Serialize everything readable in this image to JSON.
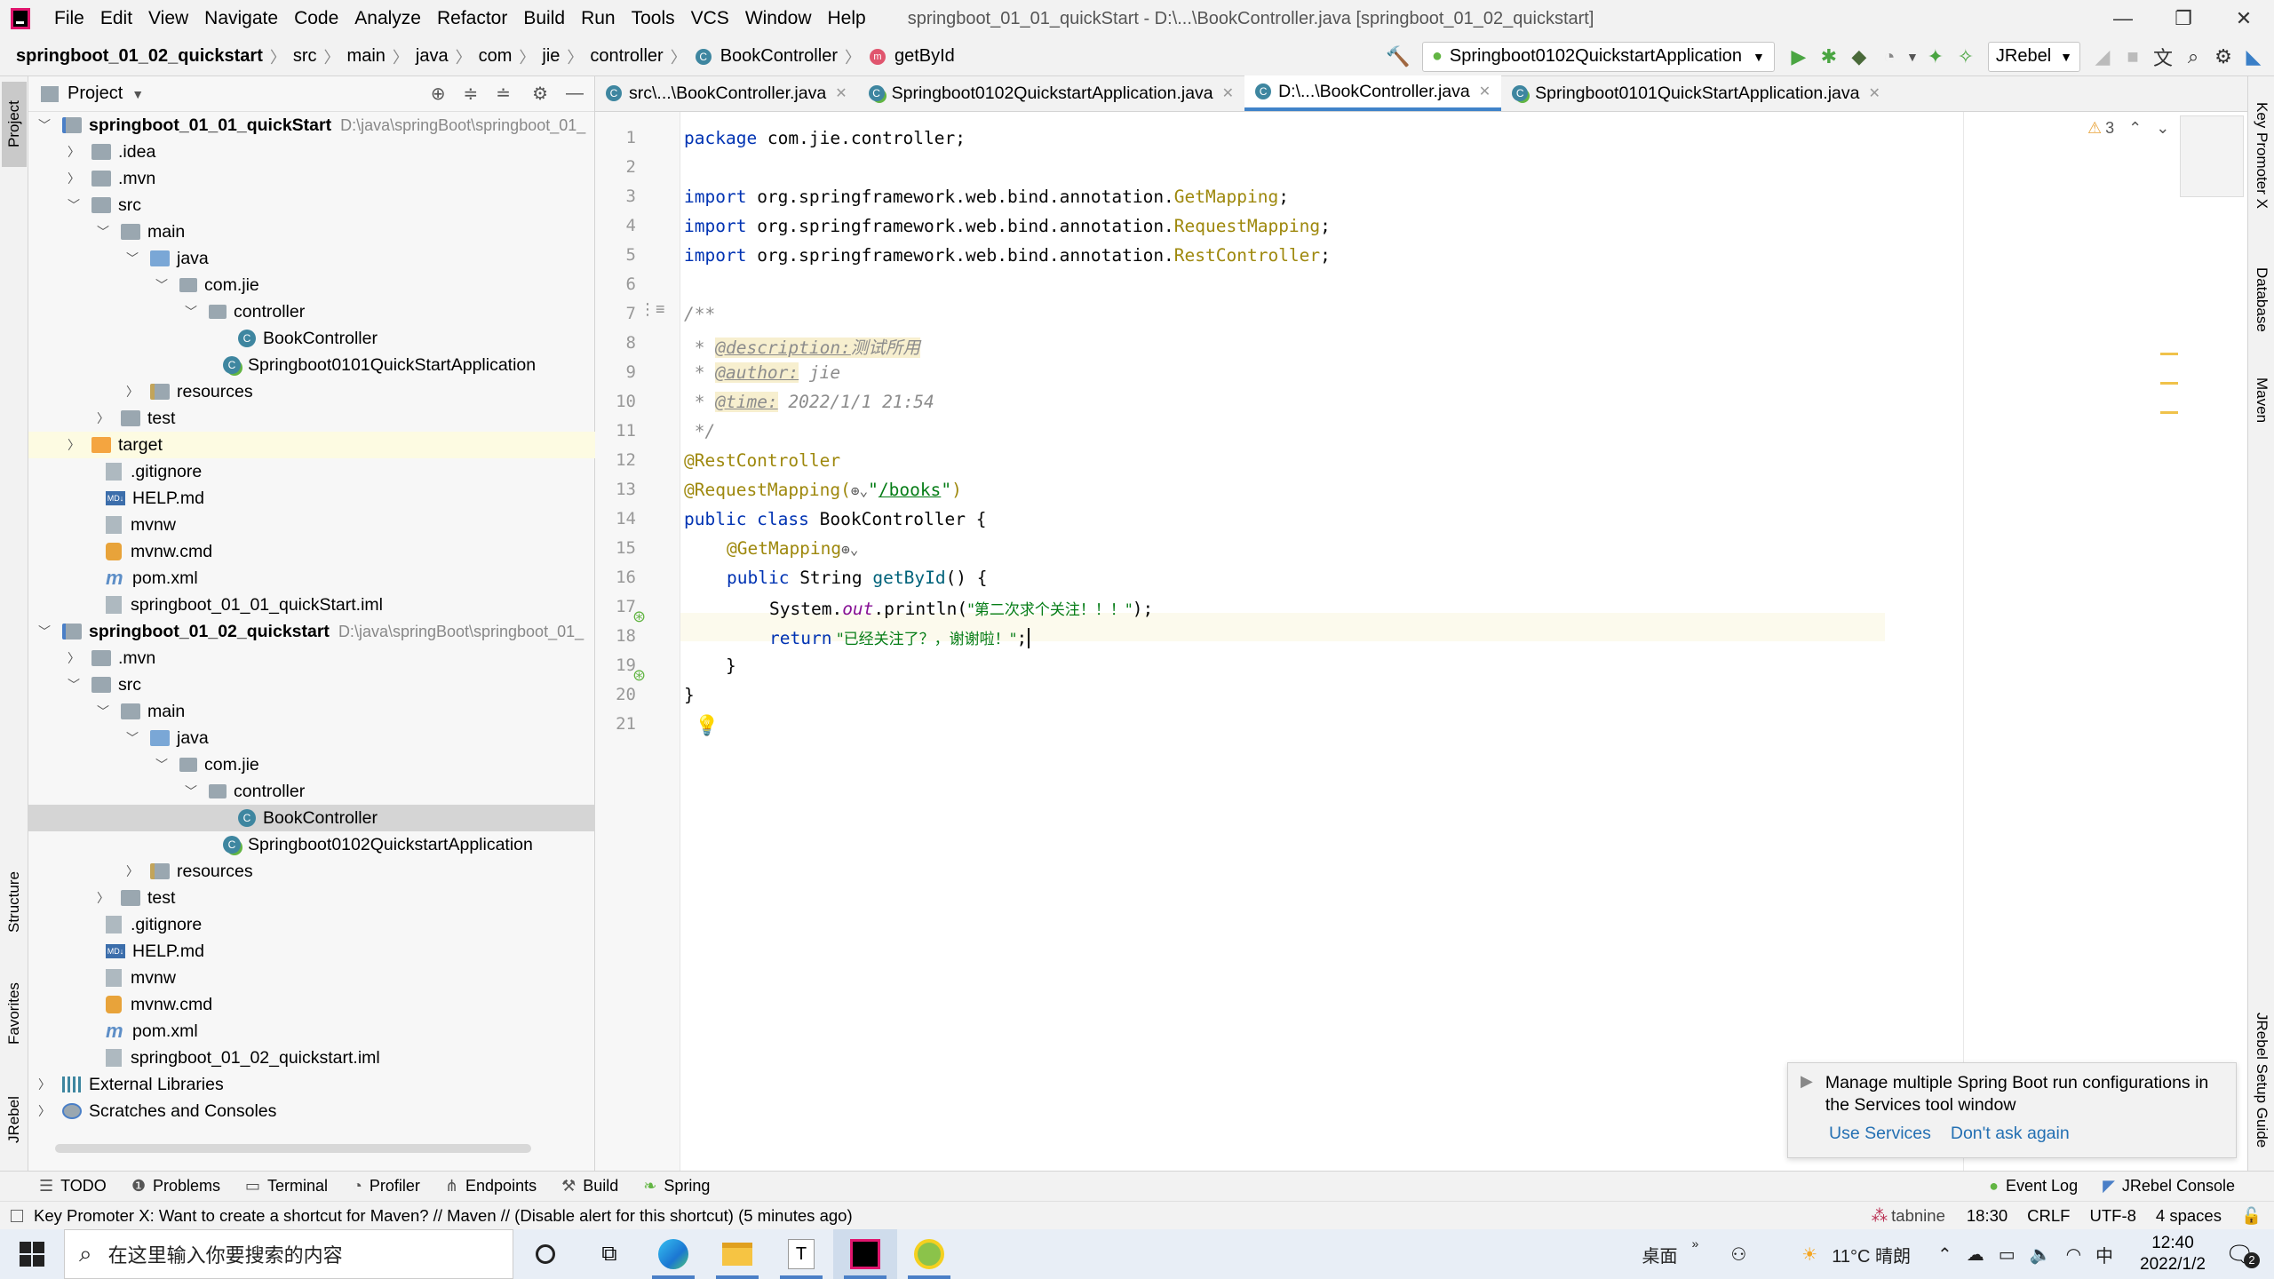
{
  "menu": {
    "items": [
      "File",
      "Edit",
      "View",
      "Navigate",
      "Code",
      "Analyze",
      "Refactor",
      "Build",
      "Run",
      "Tools",
      "VCS",
      "Window",
      "Help"
    ],
    "window_title": "springboot_01_01_quickStart - D:\\...\\BookController.java [springboot_01_02_quickstart]"
  },
  "navbar": {
    "crumbs": [
      "springboot_01_02_quickstart",
      "src",
      "main",
      "java",
      "com",
      "jie",
      "controller",
      "BookController",
      "getById"
    ],
    "run_config": "Springboot0102QuickstartApplication",
    "jrebel": "JRebel"
  },
  "left_strip": {
    "project": "Project",
    "structure": "Structure",
    "favorites": "Favorites",
    "jrebel": "JRebel"
  },
  "right_strip": {
    "key_promoter": "Key Promoter X",
    "database": "Database",
    "maven": "Maven",
    "jrebel_guide": "JRebel Setup Guide"
  },
  "project_panel": {
    "title": "Project",
    "tree": [
      {
        "label": "springboot_01_01_quickStart",
        "path": "D:\\java\\springBoot\\springboot_01_",
        "depth": 0,
        "open": true,
        "icon": "module",
        "bold": true
      },
      {
        "label": ".idea",
        "depth": 1,
        "open": false,
        "icon": "folder"
      },
      {
        "label": ".mvn",
        "depth": 1,
        "open": false,
        "icon": "folder"
      },
      {
        "label": "src",
        "depth": 1,
        "open": true,
        "icon": "folder"
      },
      {
        "label": "main",
        "depth": 2,
        "open": true,
        "icon": "folder"
      },
      {
        "label": "java",
        "depth": 3,
        "open": true,
        "icon": "folder-blue"
      },
      {
        "label": "com.jie",
        "depth": 4,
        "open": true,
        "icon": "package"
      },
      {
        "label": "controller",
        "depth": 5,
        "open": true,
        "icon": "package"
      },
      {
        "label": "BookController",
        "depth": 6,
        "icon": "class"
      },
      {
        "label": "Springboot0101QuickStartApplication",
        "depth": 5.5,
        "icon": "spring-class"
      },
      {
        "label": "resources",
        "depth": 3,
        "open": false,
        "icon": "folder-res"
      },
      {
        "label": "test",
        "depth": 2,
        "open": false,
        "icon": "folder"
      },
      {
        "label": "target",
        "depth": 1,
        "open": false,
        "icon": "folder-orange",
        "hl": true
      },
      {
        "label": ".gitignore",
        "depth": 1.5,
        "icon": "file"
      },
      {
        "label": "HELP.md",
        "depth": 1.5,
        "icon": "md"
      },
      {
        "label": "mvnw",
        "depth": 1.5,
        "icon": "file"
      },
      {
        "label": "mvnw.cmd",
        "depth": 1.5,
        "icon": "cmd"
      },
      {
        "label": "pom.xml",
        "depth": 1.5,
        "icon": "maven"
      },
      {
        "label": "springboot_01_01_quickStart.iml",
        "depth": 1.5,
        "icon": "file"
      },
      {
        "label": "springboot_01_02_quickstart",
        "path": "D:\\java\\springBoot\\springboot_01_",
        "depth": 0,
        "open": true,
        "icon": "module",
        "bold": true
      },
      {
        "label": ".mvn",
        "depth": 1,
        "open": false,
        "icon": "folder"
      },
      {
        "label": "src",
        "depth": 1,
        "open": true,
        "icon": "folder"
      },
      {
        "label": "main",
        "depth": 2,
        "open": true,
        "icon": "folder"
      },
      {
        "label": "java",
        "depth": 3,
        "open": true,
        "icon": "folder-blue"
      },
      {
        "label": "com.jie",
        "depth": 4,
        "open": true,
        "icon": "package"
      },
      {
        "label": "controller",
        "depth": 5,
        "open": true,
        "icon": "package"
      },
      {
        "label": "BookController",
        "depth": 6,
        "icon": "class",
        "selected": true
      },
      {
        "label": "Springboot0102QuickstartApplication",
        "depth": 5.5,
        "icon": "spring-class"
      },
      {
        "label": "resources",
        "depth": 3,
        "open": false,
        "icon": "folder-res"
      },
      {
        "label": "test",
        "depth": 2,
        "open": false,
        "icon": "folder"
      },
      {
        "label": ".gitignore",
        "depth": 1.5,
        "icon": "file"
      },
      {
        "label": "HELP.md",
        "depth": 1.5,
        "icon": "md"
      },
      {
        "label": "mvnw",
        "depth": 1.5,
        "icon": "file"
      },
      {
        "label": "mvnw.cmd",
        "depth": 1.5,
        "icon": "cmd"
      },
      {
        "label": "pom.xml",
        "depth": 1.5,
        "icon": "maven"
      },
      {
        "label": "springboot_01_02_quickstart.iml",
        "depth": 1.5,
        "icon": "file"
      },
      {
        "label": "External Libraries",
        "depth": 0,
        "open": false,
        "icon": "libs"
      },
      {
        "label": "Scratches and Consoles",
        "depth": 0,
        "open": false,
        "icon": "scratch"
      }
    ]
  },
  "editor_tabs": [
    {
      "label": "src\\...\\BookController.java",
      "active": false
    },
    {
      "label": "Springboot0102QuickstartApplication.java",
      "active": false
    },
    {
      "label": "D:\\...\\BookController.java",
      "active": true
    },
    {
      "label": "Springboot0101QuickStartApplication.java",
      "active": false
    }
  ],
  "editor": {
    "warnings": "3",
    "line_numbers": [
      "1",
      "2",
      "3",
      "4",
      "5",
      "6",
      "7",
      "8",
      "9",
      "10",
      "11",
      "12",
      "13",
      "14",
      "15",
      "16",
      "17",
      "18",
      "19",
      "20",
      "21"
    ],
    "code": {
      "l1_kw": "package",
      "l1_rest": " com.jie.controller;",
      "imp": "import",
      "l3_pkg": " org.springframework.web.bind.annotation.",
      "l3_cls": "GetMapping",
      "l4_cls": "RequestMapping",
      "l5_cls": "RestController",
      "semi": ";",
      "l7": "/**",
      "star": " * ",
      "l8_tag": "@description:",
      "l8_val": "测试所用",
      "l9_tag": "@author:",
      "l9_val": " jie",
      "l10_tag": "@time:",
      "l10_val": " 2022/1/1 21:54",
      "l11": " */",
      "l12": "@RestController",
      "l13_a": "@RequestMapping(",
      "l13_s1": "\"",
      "l13_path": "/books",
      "l13_s2": "\"",
      "l13_e": ")",
      "l14_kw": "public class",
      "l14_rest": " BookController {",
      "l15": "@GetMapping",
      "l16_kw": "public",
      "l16_t": " String ",
      "l16_fn": "getById",
      "l16_rest": "() {",
      "l17_a": "System.",
      "l17_out": "out",
      "l17_b": ".println(",
      "l17_str": "\"第二次求个关注！！！\"",
      "l17_c": ");",
      "l18_kw": "return",
      "l18_str": " \"已经关注了？，谢谢啦！\"",
      "l18_c": ";",
      "l19": "    }",
      "l20": "}"
    }
  },
  "notification": {
    "text": "Manage multiple Spring Boot run configurations in the Services tool window",
    "action1": "Use Services",
    "action2": "Don't ask again"
  },
  "bottom_tools": {
    "todo": "TODO",
    "problems": "Problems",
    "terminal": "Terminal",
    "profiler": "Profiler",
    "endpoints": "Endpoints",
    "build": "Build",
    "spring": "Spring",
    "event_log": "Event Log",
    "jrebel_console": "JRebel Console"
  },
  "status": {
    "message": "Key Promoter X: Want to create a shortcut for Maven? // Maven // (Disable alert for this shortcut) (5 minutes ago)",
    "tabnine": "tabnine",
    "position": "18:30",
    "line_sep": "CRLF",
    "encoding": "UTF-8",
    "indent": "4 spaces"
  },
  "taskbar": {
    "search_placeholder": "在这里输入你要搜索的内容",
    "desktop": "桌面",
    "temp": "11°C 晴朗",
    "ime": "中",
    "time": "12:40",
    "date": "2022/1/2",
    "notif_count": "2"
  }
}
